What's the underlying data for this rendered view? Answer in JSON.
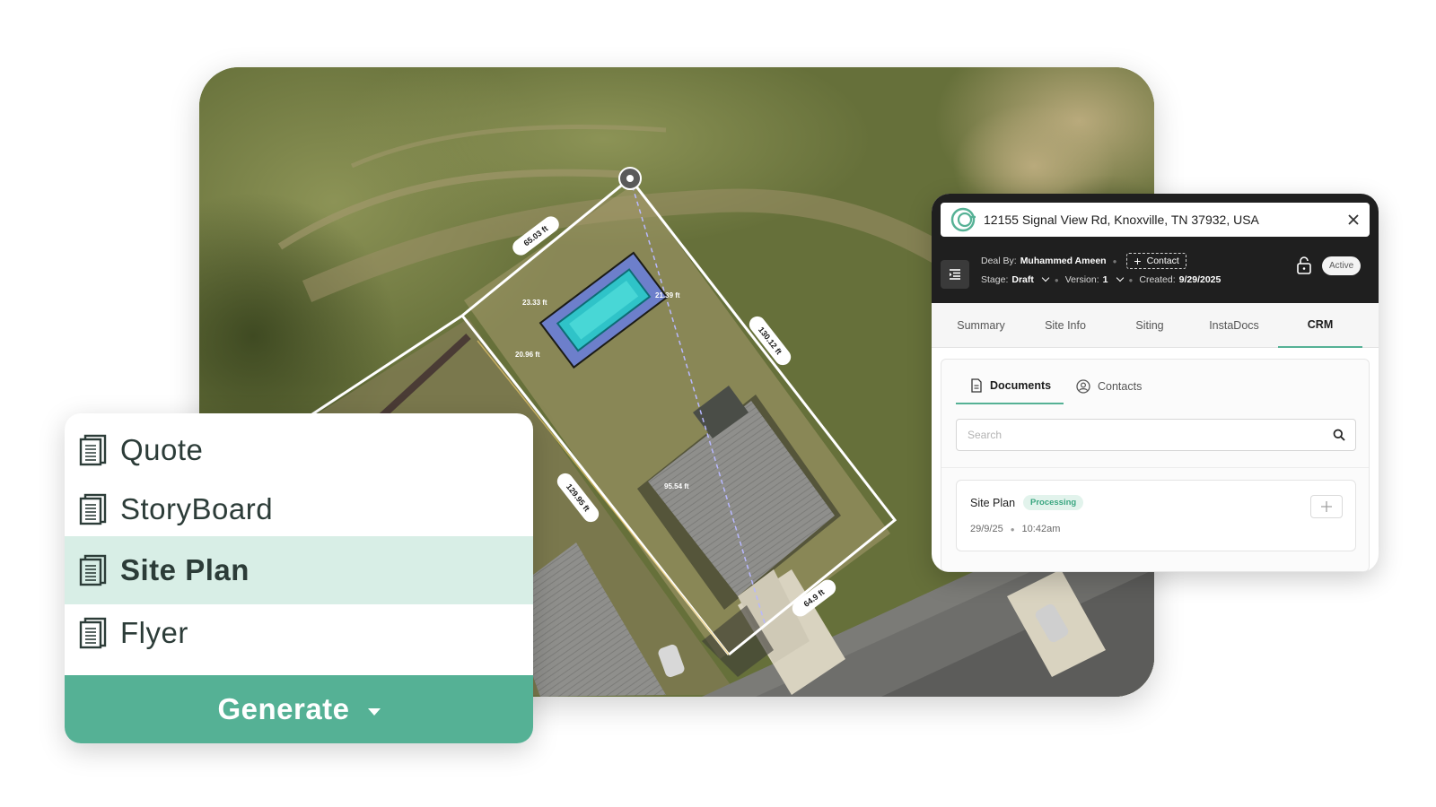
{
  "map": {
    "measurements": {
      "top_edge": "65.03 ft",
      "right_edge": "130.12 ft",
      "left_edge": "129.95 ft",
      "bottom_edge": "64.9 ft",
      "diagonal": "95.54 ft",
      "pool_left": "23.33 ft",
      "pool_right": "21.39 ft",
      "pool_bottom_left": "20.96 ft"
    }
  },
  "menu": {
    "items": [
      {
        "label": "Quote",
        "icon": "document-icon"
      },
      {
        "label": "StoryBoard",
        "icon": "document-icon"
      },
      {
        "label": "Site Plan",
        "icon": "document-icon"
      },
      {
        "label": "Flyer",
        "icon": "document-icon"
      }
    ],
    "selected_index": 2,
    "generate_label": "Generate"
  },
  "crm": {
    "address": "12155 Signal View Rd, Knoxville, TN 37932, USA",
    "deal_by_label": "Deal By:",
    "deal_by_value": "Muhammed Ameen",
    "contact_label": "Contact",
    "stage_label": "Stage:",
    "stage_value": "Draft",
    "version_label": "Version:",
    "version_value": "1",
    "created_label": "Created:",
    "created_value": "9/29/2025",
    "status": "Active",
    "tabs": [
      "Summary",
      "Site Info",
      "Siting",
      "InstaDocs",
      "CRM"
    ],
    "active_tab": "CRM",
    "subtabs": [
      "Documents",
      "Contacts"
    ],
    "active_subtab": "Documents",
    "search_placeholder": "Search",
    "document": {
      "title": "Site Plan",
      "badge": "Processing",
      "date": "29/9/25",
      "time": "10:42am"
    }
  },
  "colors": {
    "accent": "#55b195",
    "selected_bg": "#d8eee6",
    "header_dark": "#1f1f1f",
    "badge_bg": "#e2f3ec",
    "badge_text": "#3aa680"
  }
}
